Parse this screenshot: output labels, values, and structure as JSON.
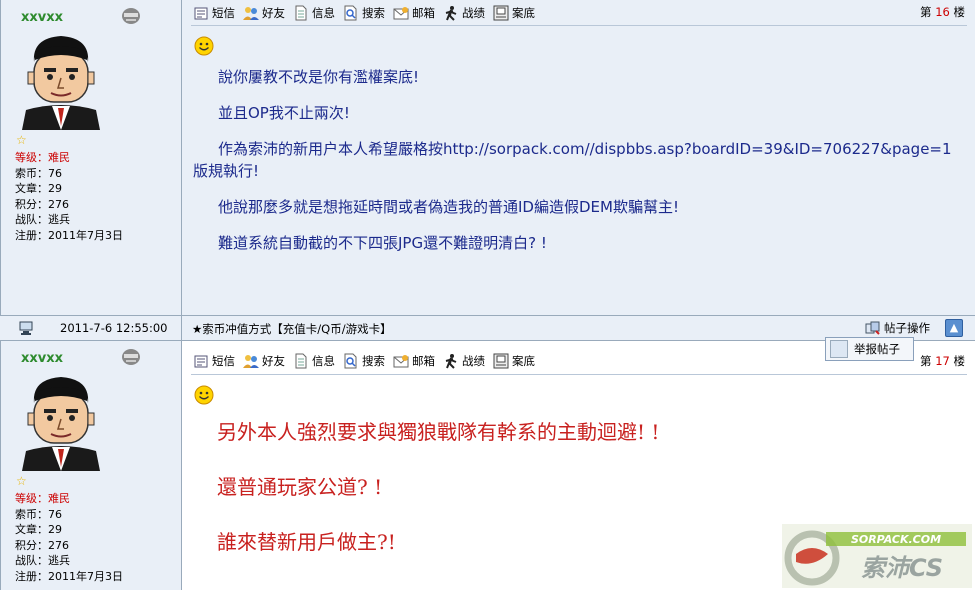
{
  "posts": [
    {
      "user": {
        "name": "xxvxx",
        "rank_label": "等级：",
        "rank_value": "难民",
        "coins": "索币：76",
        "articles": "文章：29",
        "points": "积分：276",
        "team": "战队：逃兵",
        "registered": "注册：2011年7月3日"
      },
      "toolbar": [
        "短信",
        "好友",
        "信息",
        "搜索",
        "邮箱",
        "战绩",
        "案底"
      ],
      "floor_prefix": "第",
      "floor_number": "16",
      "floor_suffix": "楼",
      "paragraphs": [
        "說你屢教不改是你有濫權案底!",
        "並且OP我不止兩次!",
        "作為索沛的新用户本人希望嚴格按http://sorpack.com//dispbbs.asp?boardID=39&ID=706227&page=1版規執行!",
        "他說那麼多就是想拖延時間或者偽造我的普通ID編造假DEM欺騙幫主!",
        "難道系統自動截的不下四張JPG還不難證明清白? !"
      ]
    },
    {
      "user": {
        "name": "xxvxx",
        "rank_label": "等级：",
        "rank_value": "难民",
        "coins": "索币：76",
        "articles": "文章：29",
        "points": "积分：276",
        "team": "战队：逃兵",
        "registered": "注册：2011年7月3日"
      },
      "toolbar": [
        "短信",
        "好友",
        "信息",
        "搜索",
        "邮箱",
        "战绩",
        "案底"
      ],
      "floor_prefix": "第",
      "floor_number": "17",
      "floor_suffix": "楼",
      "paragraphs": [
        "另外本人強烈要求與獨狼戰隊有幹系的主動迴避! !",
        "還普通玩家公道? !",
        "誰來替新用戶做主?!"
      ]
    }
  ],
  "footer": {
    "date": "2011-7-6 12:55:00",
    "ad": "★索币冲值方式【充值卡/Q币/游戏卡】",
    "post_ops": "帖子操作",
    "up_icon": "arrow-up-icon"
  },
  "popup": {
    "report": "举报帖子"
  },
  "colors": {
    "pane_bg": "#e9eff7",
    "post1_text": "#1c2a8c",
    "post2_text": "#c8211f",
    "username": "#2e8b2e",
    "rank": "#cc0000"
  },
  "watermark": {
    "text_top": "SORPACK.COM",
    "text_bottom": "索沛CS"
  }
}
